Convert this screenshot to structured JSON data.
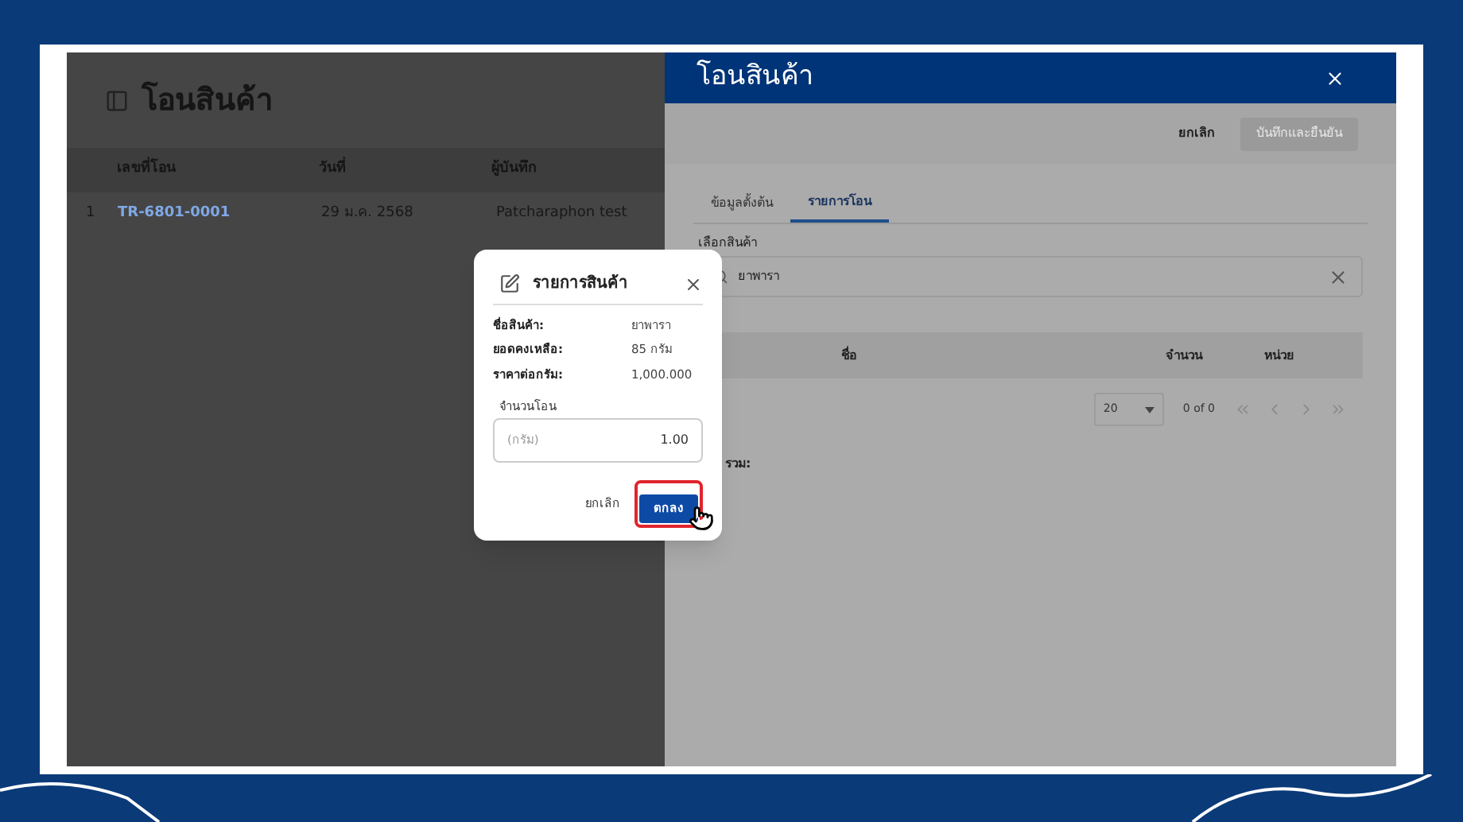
{
  "page": {
    "title": "โอนสินค้า",
    "columns": [
      "เลขที่โอน",
      "วันที่",
      "ผู้บันทึก"
    ],
    "rows": [
      {
        "index": "1",
        "number": "TR-6801-0001",
        "date": "29 ม.ค. 2568",
        "recorder": "Patcharaphon test"
      }
    ]
  },
  "drawer": {
    "title": "โอนสินค้า",
    "cancel": "ยกเลิก",
    "save": "บันทึกและยืนยัน",
    "save_disabled": true,
    "tabs": [
      {
        "label": "ข้อมูลตั้งต้น",
        "selected": false
      },
      {
        "label": "รายการโอน",
        "selected": true
      }
    ],
    "product_field": {
      "label": "เลือกสินค้า",
      "value": "ยาพารา"
    },
    "table_columns": [
      "ชื่อ",
      "จำนวน",
      "หน่วย"
    ],
    "pagination": {
      "page_size": "20",
      "range": "0 of 0"
    },
    "total_label": "รวม:"
  },
  "dialog": {
    "title": "รายการสินค้า",
    "details": [
      {
        "label": "ชื่อสินค้า:",
        "value": "ยาพารา"
      },
      {
        "label": "ยอดคงเหลือ:",
        "value": "85 กรัม"
      },
      {
        "label": "ราคาต่อกรัม:",
        "value": "1,000.000"
      }
    ],
    "quantity": {
      "label": "จำนวนโอน",
      "unit": "(กรัม)",
      "value": "1.00"
    },
    "cancel": "ยกเลิก",
    "ok": "ตกลง"
  }
}
